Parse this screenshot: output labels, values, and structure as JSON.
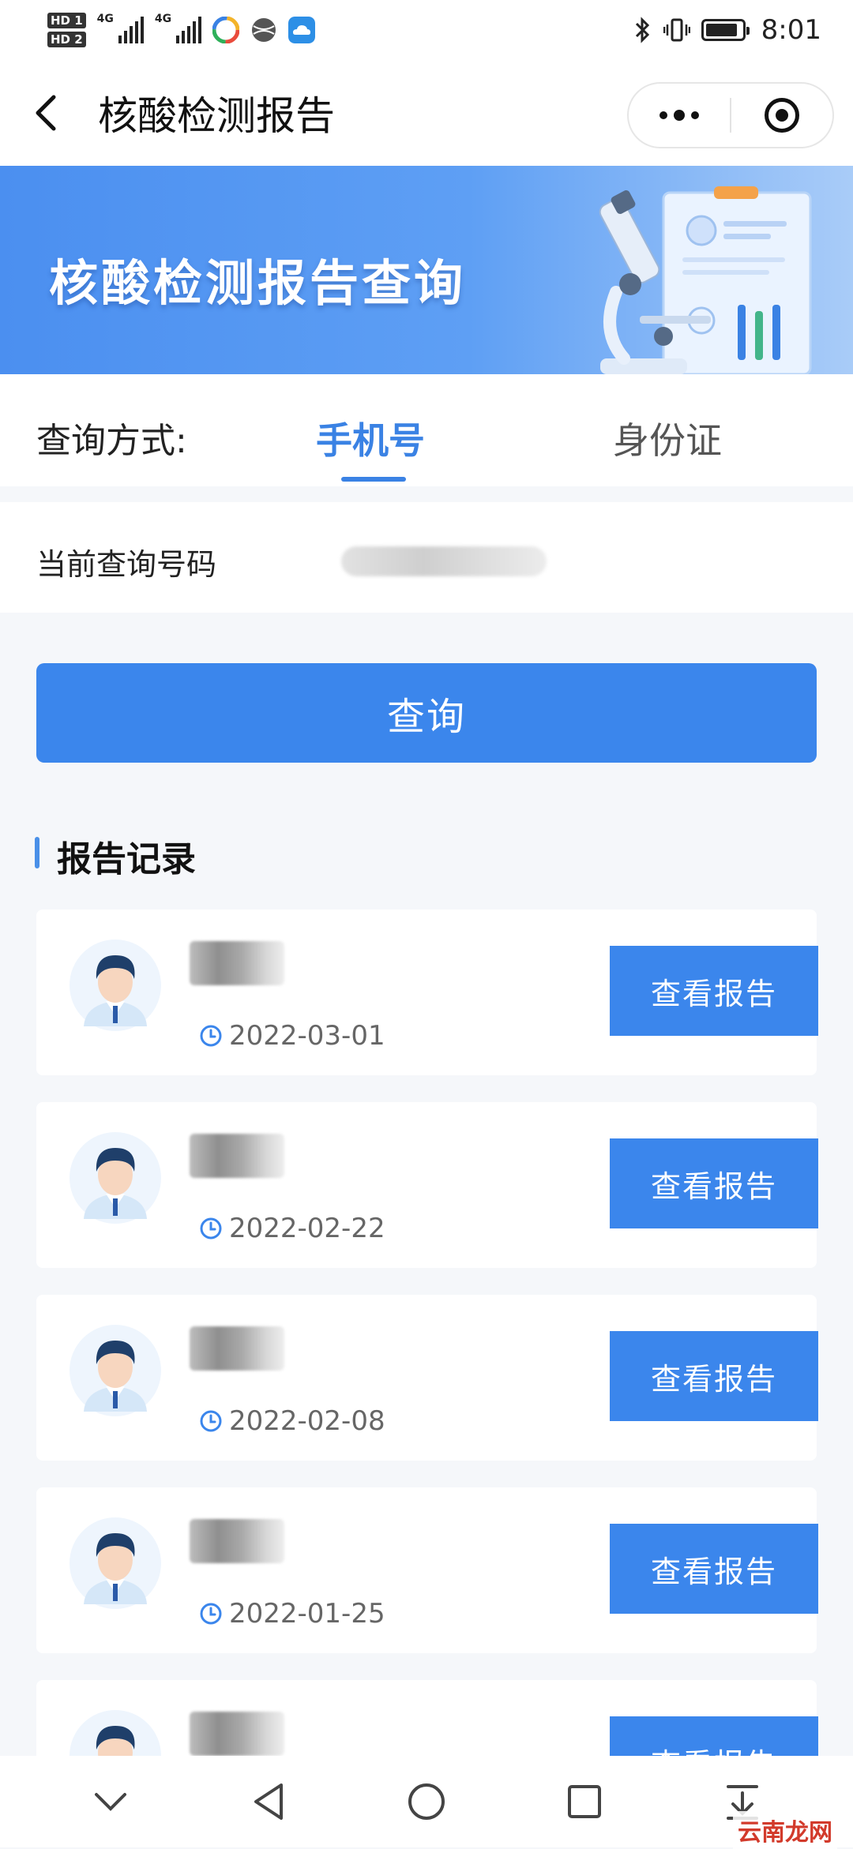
{
  "status_bar": {
    "hd1": "HD 1",
    "hd2": "HD 2",
    "network1": "4G",
    "network2": "4G",
    "time": "8:01"
  },
  "nav": {
    "title": "核酸检测报告"
  },
  "banner": {
    "title": "核酸检测报告查询"
  },
  "query_method": {
    "label": "查询方式:",
    "tabs": [
      {
        "label": "手机号",
        "active": true
      },
      {
        "label": "身份证",
        "active": false
      }
    ]
  },
  "current_number": {
    "label": "当前查询号码"
  },
  "query_button": "查询",
  "records": {
    "title": "报告记录",
    "items": [
      {
        "date": "2022-03-01",
        "button": "查看报告"
      },
      {
        "date": "2022-02-22",
        "button": "查看报告"
      },
      {
        "date": "2022-02-08",
        "button": "查看报告"
      },
      {
        "date": "2022-01-25",
        "button": "查看报告"
      },
      {
        "date": "",
        "button": "查看报告"
      }
    ]
  },
  "watermark": "云南龙网",
  "colors": {
    "accent": "#3b86ec",
    "banner_start": "#4b8ff0",
    "banner_end": "#a9ccf8",
    "watermark": "#d23a2b"
  }
}
